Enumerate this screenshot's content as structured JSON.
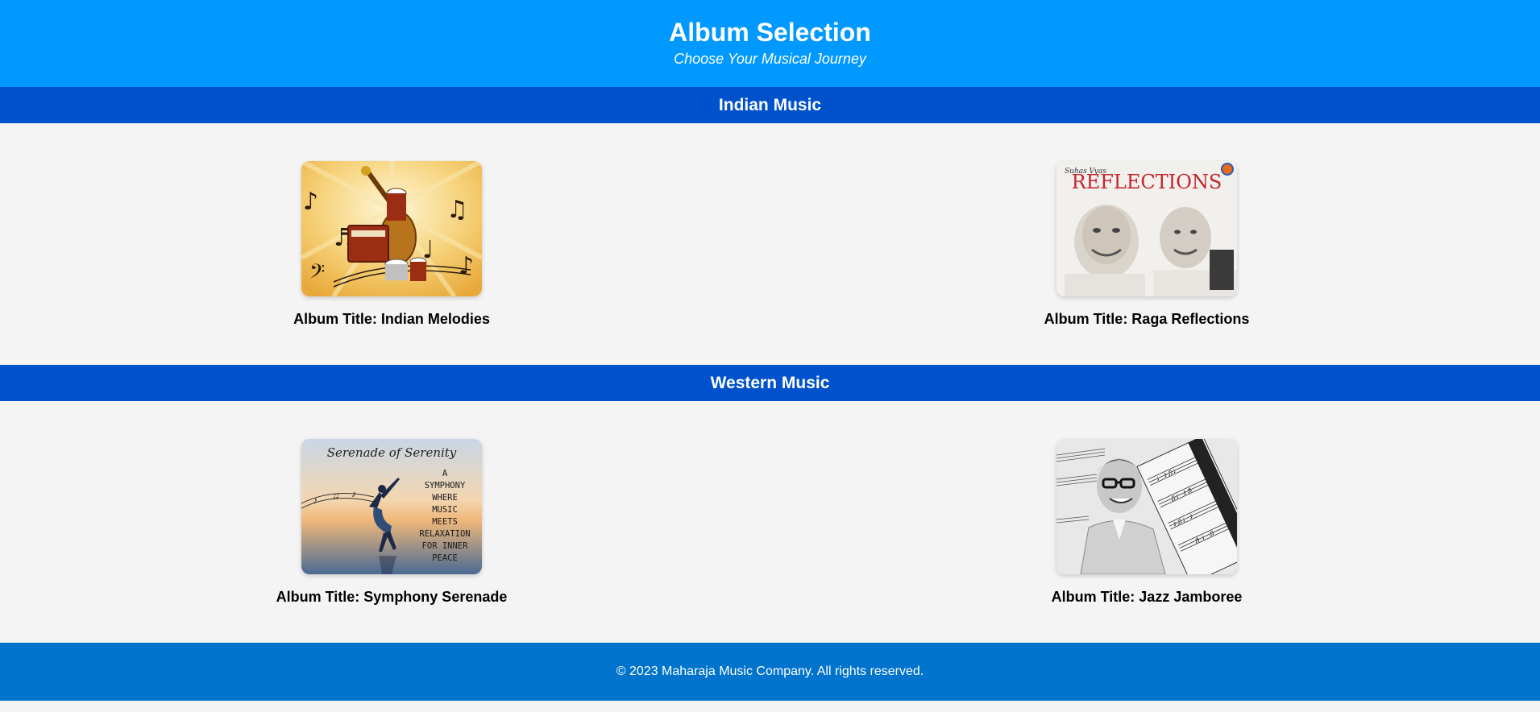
{
  "header": {
    "title": "Album Selection",
    "subtitle": "Choose Your Musical Journey"
  },
  "sections": [
    {
      "heading": "Indian Music",
      "albums": [
        {
          "title": "Album Title: Indian Melodies",
          "cover_icon": "indian-instruments-cover"
        },
        {
          "title": "Album Title: Raga Reflections",
          "cover_icon": "raga-reflections-cover",
          "cover_text": {
            "artist": "Suhas Vyas",
            "word": "REFLECTIONS"
          }
        }
      ]
    },
    {
      "heading": "Western Music",
      "albums": [
        {
          "title": "Album Title: Symphony Serenade",
          "cover_icon": "serenade-dancer-cover",
          "cover_text": {
            "heading": "Serenade of Serenity",
            "lines": [
              "A",
              "SYMPHONY",
              "WHERE",
              "MUSIC",
              "MEETS",
              "RELAXATION",
              "FOR INNER",
              "PEACE"
            ]
          }
        },
        {
          "title": "Album Title: Jazz Jamboree",
          "cover_icon": "jazz-pianist-cover"
        }
      ]
    }
  ],
  "footer": {
    "text": "© 2023 Maharaja Music Company. All rights reserved."
  },
  "colors": {
    "header_bg": "#0099ff",
    "section_bg": "#0052cc",
    "footer_bg": "#0073cc",
    "page_bg": "#f4f4f4"
  }
}
